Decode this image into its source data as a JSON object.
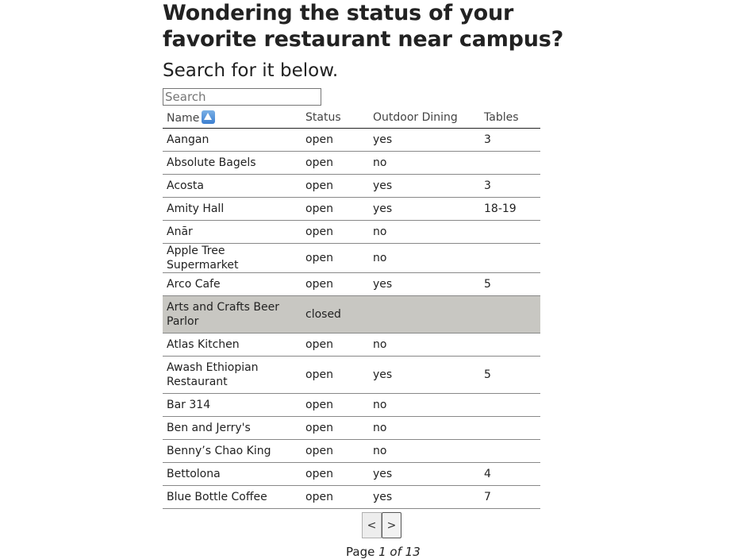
{
  "header": {
    "title": "Wondering the status of your favorite restaurant near campus?",
    "subtitle": "Search for it below."
  },
  "search": {
    "placeholder": "Search",
    "value": ""
  },
  "table": {
    "columns": [
      "Name",
      "Status",
      "Outdoor Dining",
      "Tables"
    ],
    "sort_icon": "up-arrow-icon",
    "rows": [
      {
        "name": "Aangan",
        "status": "open",
        "outdoor": "yes",
        "tables": "3"
      },
      {
        "name": "Absolute Bagels",
        "status": "open",
        "outdoor": "no",
        "tables": ""
      },
      {
        "name": "Acosta",
        "status": "open",
        "outdoor": "yes",
        "tables": "3"
      },
      {
        "name": "Amity Hall",
        "status": "open",
        "outdoor": "yes",
        "tables": "18-19"
      },
      {
        "name": "Anār",
        "status": "open",
        "outdoor": "no",
        "tables": ""
      },
      {
        "name": "Apple Tree Supermarket",
        "status": "open",
        "outdoor": "no",
        "tables": ""
      },
      {
        "name": "Arco Cafe",
        "status": "open",
        "outdoor": "yes",
        "tables": "5"
      },
      {
        "name": "Arts and Crafts Beer Parlor",
        "status": "closed",
        "outdoor": "",
        "tables": ""
      },
      {
        "name": "Atlas Kitchen",
        "status": "open",
        "outdoor": "no",
        "tables": ""
      },
      {
        "name": "Awash Ethiopian Restaurant",
        "status": "open",
        "outdoor": "yes",
        "tables": "5"
      },
      {
        "name": "Bar 314",
        "status": "open",
        "outdoor": "no",
        "tables": ""
      },
      {
        "name": "Ben and Jerry's",
        "status": "open",
        "outdoor": "no",
        "tables": ""
      },
      {
        "name": "Benny’s Chao King",
        "status": "open",
        "outdoor": "no",
        "tables": ""
      },
      {
        "name": "Bettolona",
        "status": "open",
        "outdoor": "yes",
        "tables": "4"
      },
      {
        "name": "Blue Bottle Coffee",
        "status": "open",
        "outdoor": "yes",
        "tables": "7"
      }
    ]
  },
  "pagination": {
    "prev_label": "<",
    "next_label": ">",
    "page_prefix": "Page",
    "page_current": "1 of 13"
  },
  "colors": {
    "closed_row": "#c8c7c2"
  }
}
